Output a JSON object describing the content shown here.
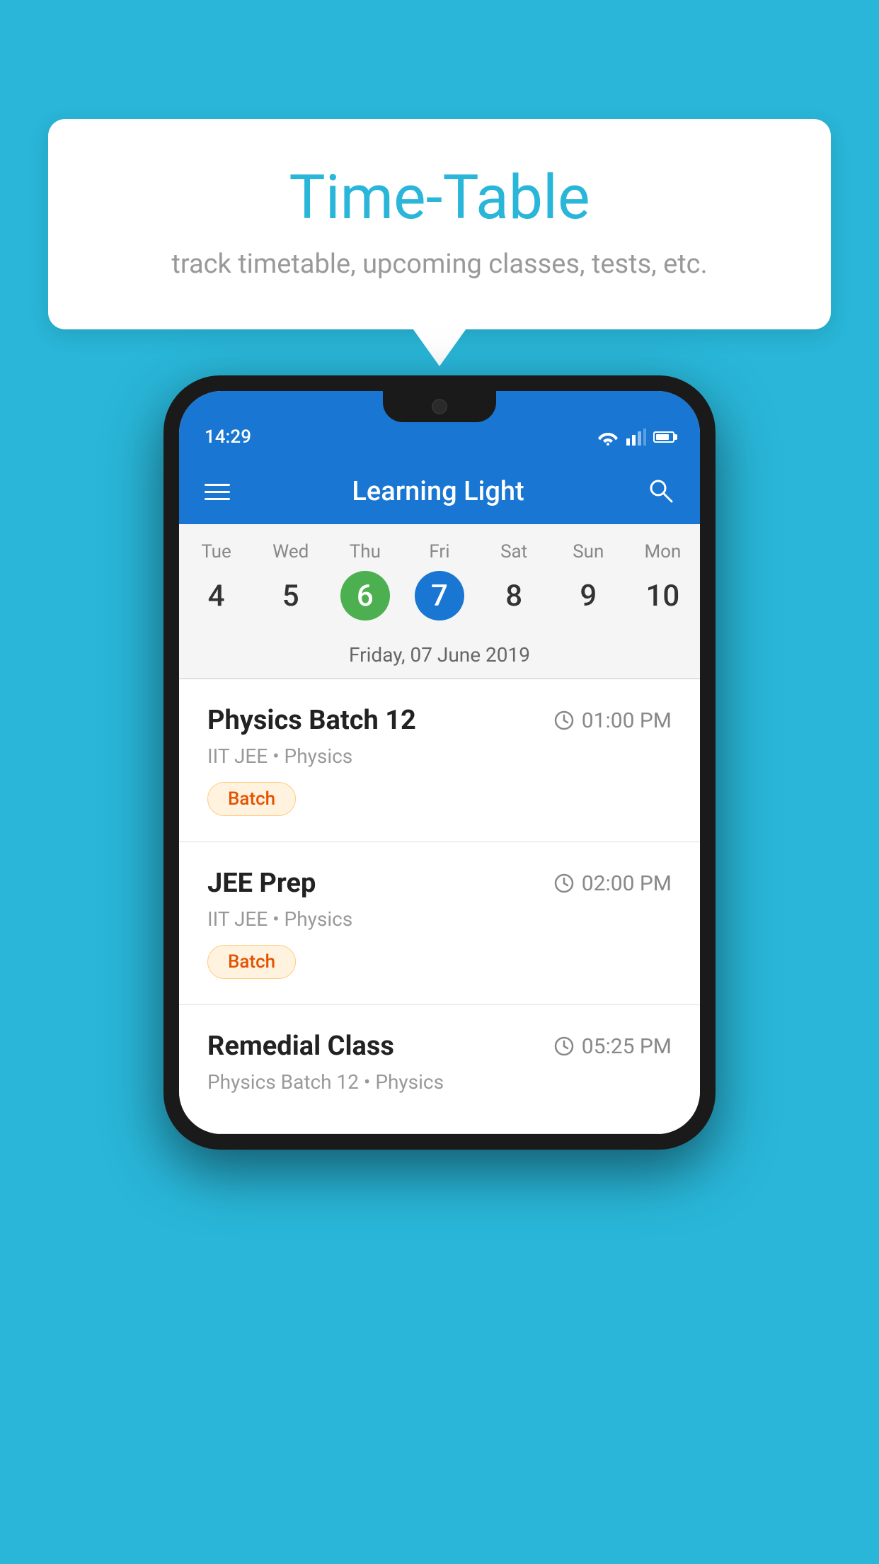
{
  "background_color": "#29b6d8",
  "tooltip": {
    "title": "Time-Table",
    "subtitle": "track timetable, upcoming classes, tests, etc."
  },
  "phone": {
    "status_bar": {
      "time": "14:29"
    },
    "app_bar": {
      "title": "Learning Light"
    },
    "calendar": {
      "days": [
        {
          "name": "Tue",
          "number": "4",
          "state": "normal"
        },
        {
          "name": "Wed",
          "number": "5",
          "state": "normal"
        },
        {
          "name": "Thu",
          "number": "6",
          "state": "today"
        },
        {
          "name": "Fri",
          "number": "7",
          "state": "selected"
        },
        {
          "name": "Sat",
          "number": "8",
          "state": "normal"
        },
        {
          "name": "Sun",
          "number": "9",
          "state": "normal"
        },
        {
          "name": "Mon",
          "number": "10",
          "state": "normal"
        }
      ],
      "selected_date_label": "Friday, 07 June 2019"
    },
    "events": [
      {
        "title": "Physics Batch 12",
        "time": "01:00 PM",
        "subtitle": "IIT JEE • Physics",
        "badge": "Batch"
      },
      {
        "title": "JEE Prep",
        "time": "02:00 PM",
        "subtitle": "IIT JEE • Physics",
        "badge": "Batch"
      },
      {
        "title": "Remedial Class",
        "time": "05:25 PM",
        "subtitle": "Physics Batch 12 • Physics",
        "badge": null
      }
    ]
  }
}
